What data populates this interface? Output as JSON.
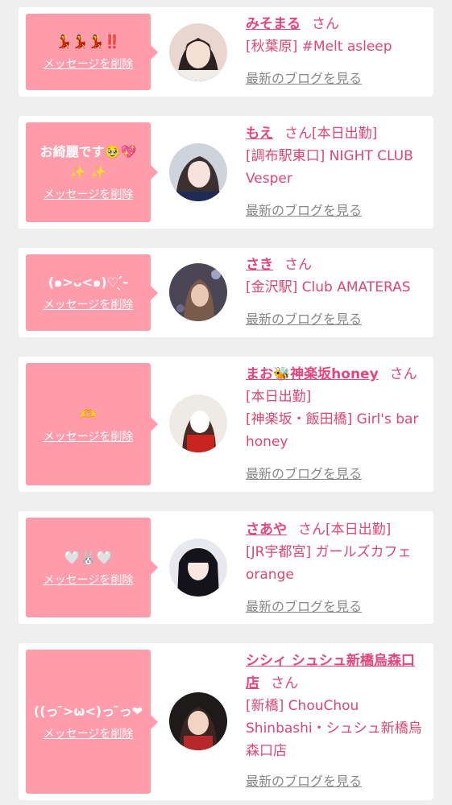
{
  "common": {
    "san": "さん",
    "delete_label": "メッセージを削除",
    "blog_label": "最新のブログを見る"
  },
  "messages": [
    {
      "bubble_text": "💃💃💃‼️",
      "name": "みそまる",
      "status": "",
      "shop": "[秋葉原] #Melt asleep"
    },
    {
      "bubble_text": "お綺麗です🥹💖\n✨ ✨",
      "name": "もえ",
      "status": "[本日出勤]",
      "shop": "[調布駅東口] NIGHT CLUB Vesper"
    },
    {
      "bubble_text": "(๑>ᴗ<๑)♡ ̖́-",
      "name": "さき",
      "status": "",
      "shop": "[金沢駅] Club AMATERAS"
    },
    {
      "bubble_text": "🫶",
      "name": "まお🐝神楽坂honey",
      "status": "[本日出勤]",
      "shop": "[神楽坂・飯田橋] Girl's bar honey"
    },
    {
      "bubble_text": "🤍🐰🤍",
      "name": "さあや",
      "status": "[本日出勤]",
      "shop": "[JR宇都宮] ガールズカフェ orange"
    },
    {
      "bubble_text": "((っ ̄>ω<)っ ̄っ❤",
      "name": "シシィ シュシュ新橋烏森口店",
      "status": "",
      "shop": "[新橋] ChouChou Shinbashi・シュシュ新橋烏森口店"
    }
  ],
  "colors": {
    "page_bg": "#efefef",
    "card_bg": "#ffffff",
    "bubble_bg": "#ff9cac",
    "accent": "#e8457a",
    "link_gray": "#888888"
  }
}
